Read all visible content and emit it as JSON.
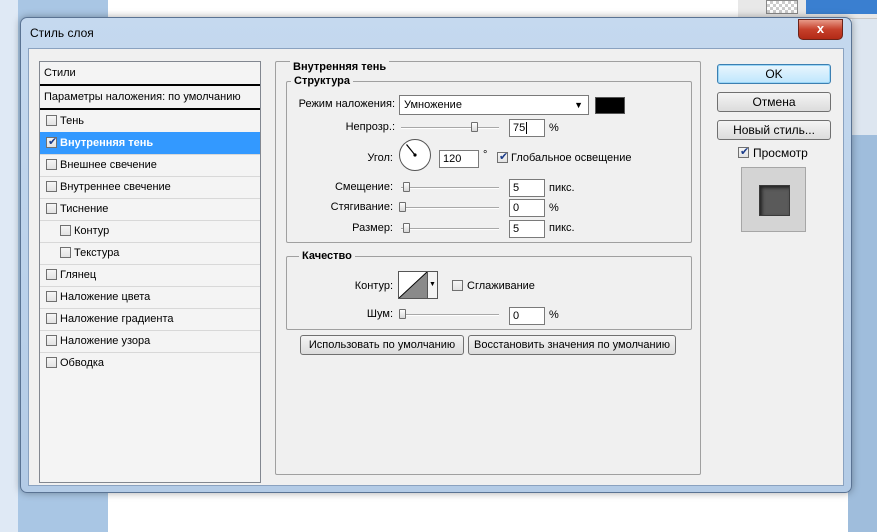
{
  "dialog": {
    "title": "Стиль слоя",
    "close_glyph": "x"
  },
  "styles_list": {
    "header": "Стили",
    "blending_options": "Параметры наложения: по умолчанию",
    "items": [
      {
        "label": "Тень",
        "checked": false
      },
      {
        "label": "Внутренняя тень",
        "checked": true,
        "selected": true
      },
      {
        "label": "Внешнее свечение",
        "checked": false
      },
      {
        "label": "Внутреннее свечение",
        "checked": false
      },
      {
        "label": "Тиснение",
        "checked": false
      },
      {
        "label": "Контур",
        "checked": false,
        "sub": true
      },
      {
        "label": "Текстура",
        "checked": false,
        "sub": true
      },
      {
        "label": "Глянец",
        "checked": false
      },
      {
        "label": "Наложение цвета",
        "checked": false
      },
      {
        "label": "Наложение градиента",
        "checked": false
      },
      {
        "label": "Наложение узора",
        "checked": false
      },
      {
        "label": "Обводка",
        "checked": false
      }
    ]
  },
  "inner_shadow": {
    "title": "Внутренняя тень",
    "structure": {
      "title": "Структура",
      "blend_mode_label": "Режим наложения:",
      "blend_mode_value": "Умножение",
      "color": "#000000",
      "opacity_label": "Непрозр.:",
      "opacity_value": "75",
      "opacity_unit": "%",
      "angle_label": "Угол:",
      "angle_value": "120",
      "angle_unit": "°",
      "global_light_label": "Глобальное освещение",
      "global_light_checked": true,
      "distance_label": "Смещение:",
      "distance_value": "5",
      "distance_unit": "пикс.",
      "choke_label": "Стягивание:",
      "choke_value": "0",
      "choke_unit": "%",
      "size_label": "Размер:",
      "size_value": "5",
      "size_unit": "пикс."
    },
    "quality": {
      "title": "Качество",
      "contour_label": "Контур:",
      "antialias_label": "Сглаживание",
      "antialias_checked": false,
      "noise_label": "Шум:",
      "noise_value": "0",
      "noise_unit": "%"
    },
    "make_default_label": "Использовать по умолчанию",
    "reset_default_label": "Восстановить значения по умолчанию"
  },
  "buttons": {
    "ok": "OK",
    "cancel": "Отмена",
    "new_style": "Новый стиль...",
    "preview_label": "Просмотр",
    "preview_checked": true
  }
}
